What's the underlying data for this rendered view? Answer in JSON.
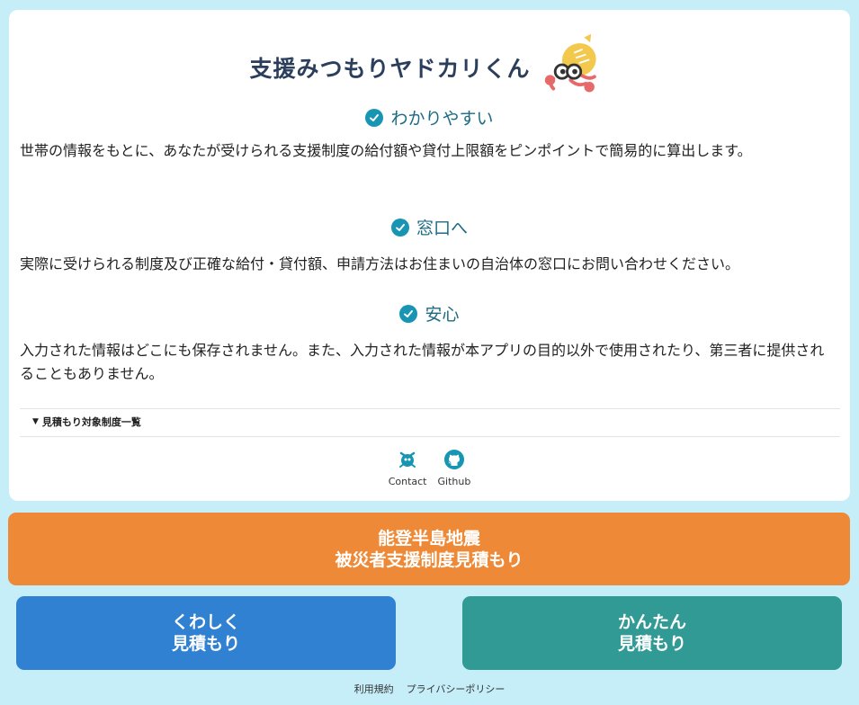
{
  "header": {
    "title": "支援みつもりヤドカリくん",
    "mascot_icon": "hermit-crab-mascot"
  },
  "sections": [
    {
      "heading": "わかりやすい",
      "text": "世帯の情報をもとに、あなたが受けられる支援制度の給付額や貸付上限額をピンポイントで簡易的に算出します。"
    },
    {
      "heading": "窓口へ",
      "text": "実際に受けられる制度及び正確な給付・貸付額、申請方法はお住まいの自治体の窓口にお問い合わせください。"
    },
    {
      "heading": "安心",
      "text": "入力された情報はどこにも保存されません。また、入力された情報が本アプリの目的以外で使用されたり、第三者に提供されることもありません。"
    }
  ],
  "accordion": {
    "label": "見積もり対象制度一覧"
  },
  "links": {
    "contact": "Contact",
    "github": "Github"
  },
  "buttons": {
    "noto_line1": "能登半島地震",
    "noto_line2": "被災者支援制度見積もり",
    "detailed_line1": "くわしく",
    "detailed_line2": "見積もり",
    "simple_line1": "かんたん",
    "simple_line2": "見積もり"
  },
  "footer": {
    "terms": "利用規約",
    "privacy": "プライバシーポリシー"
  },
  "colors": {
    "background": "#c6eef9",
    "accent_check": "#1795b3",
    "orange": "#ee8a37",
    "blue": "#3081d1",
    "teal": "#319a94"
  }
}
